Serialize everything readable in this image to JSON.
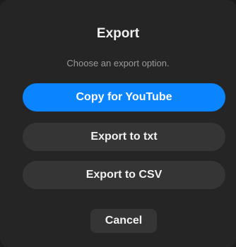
{
  "dialog": {
    "title": "Export",
    "subtitle": "Choose an export option.",
    "buttons": {
      "copy_youtube": "Copy for YouTube",
      "export_txt": "Export to txt",
      "export_csv": "Export to CSV",
      "cancel": "Cancel"
    },
    "colors": {
      "accent": "#0a84ff",
      "background": "#252525",
      "secondary_button": "#353535"
    }
  }
}
